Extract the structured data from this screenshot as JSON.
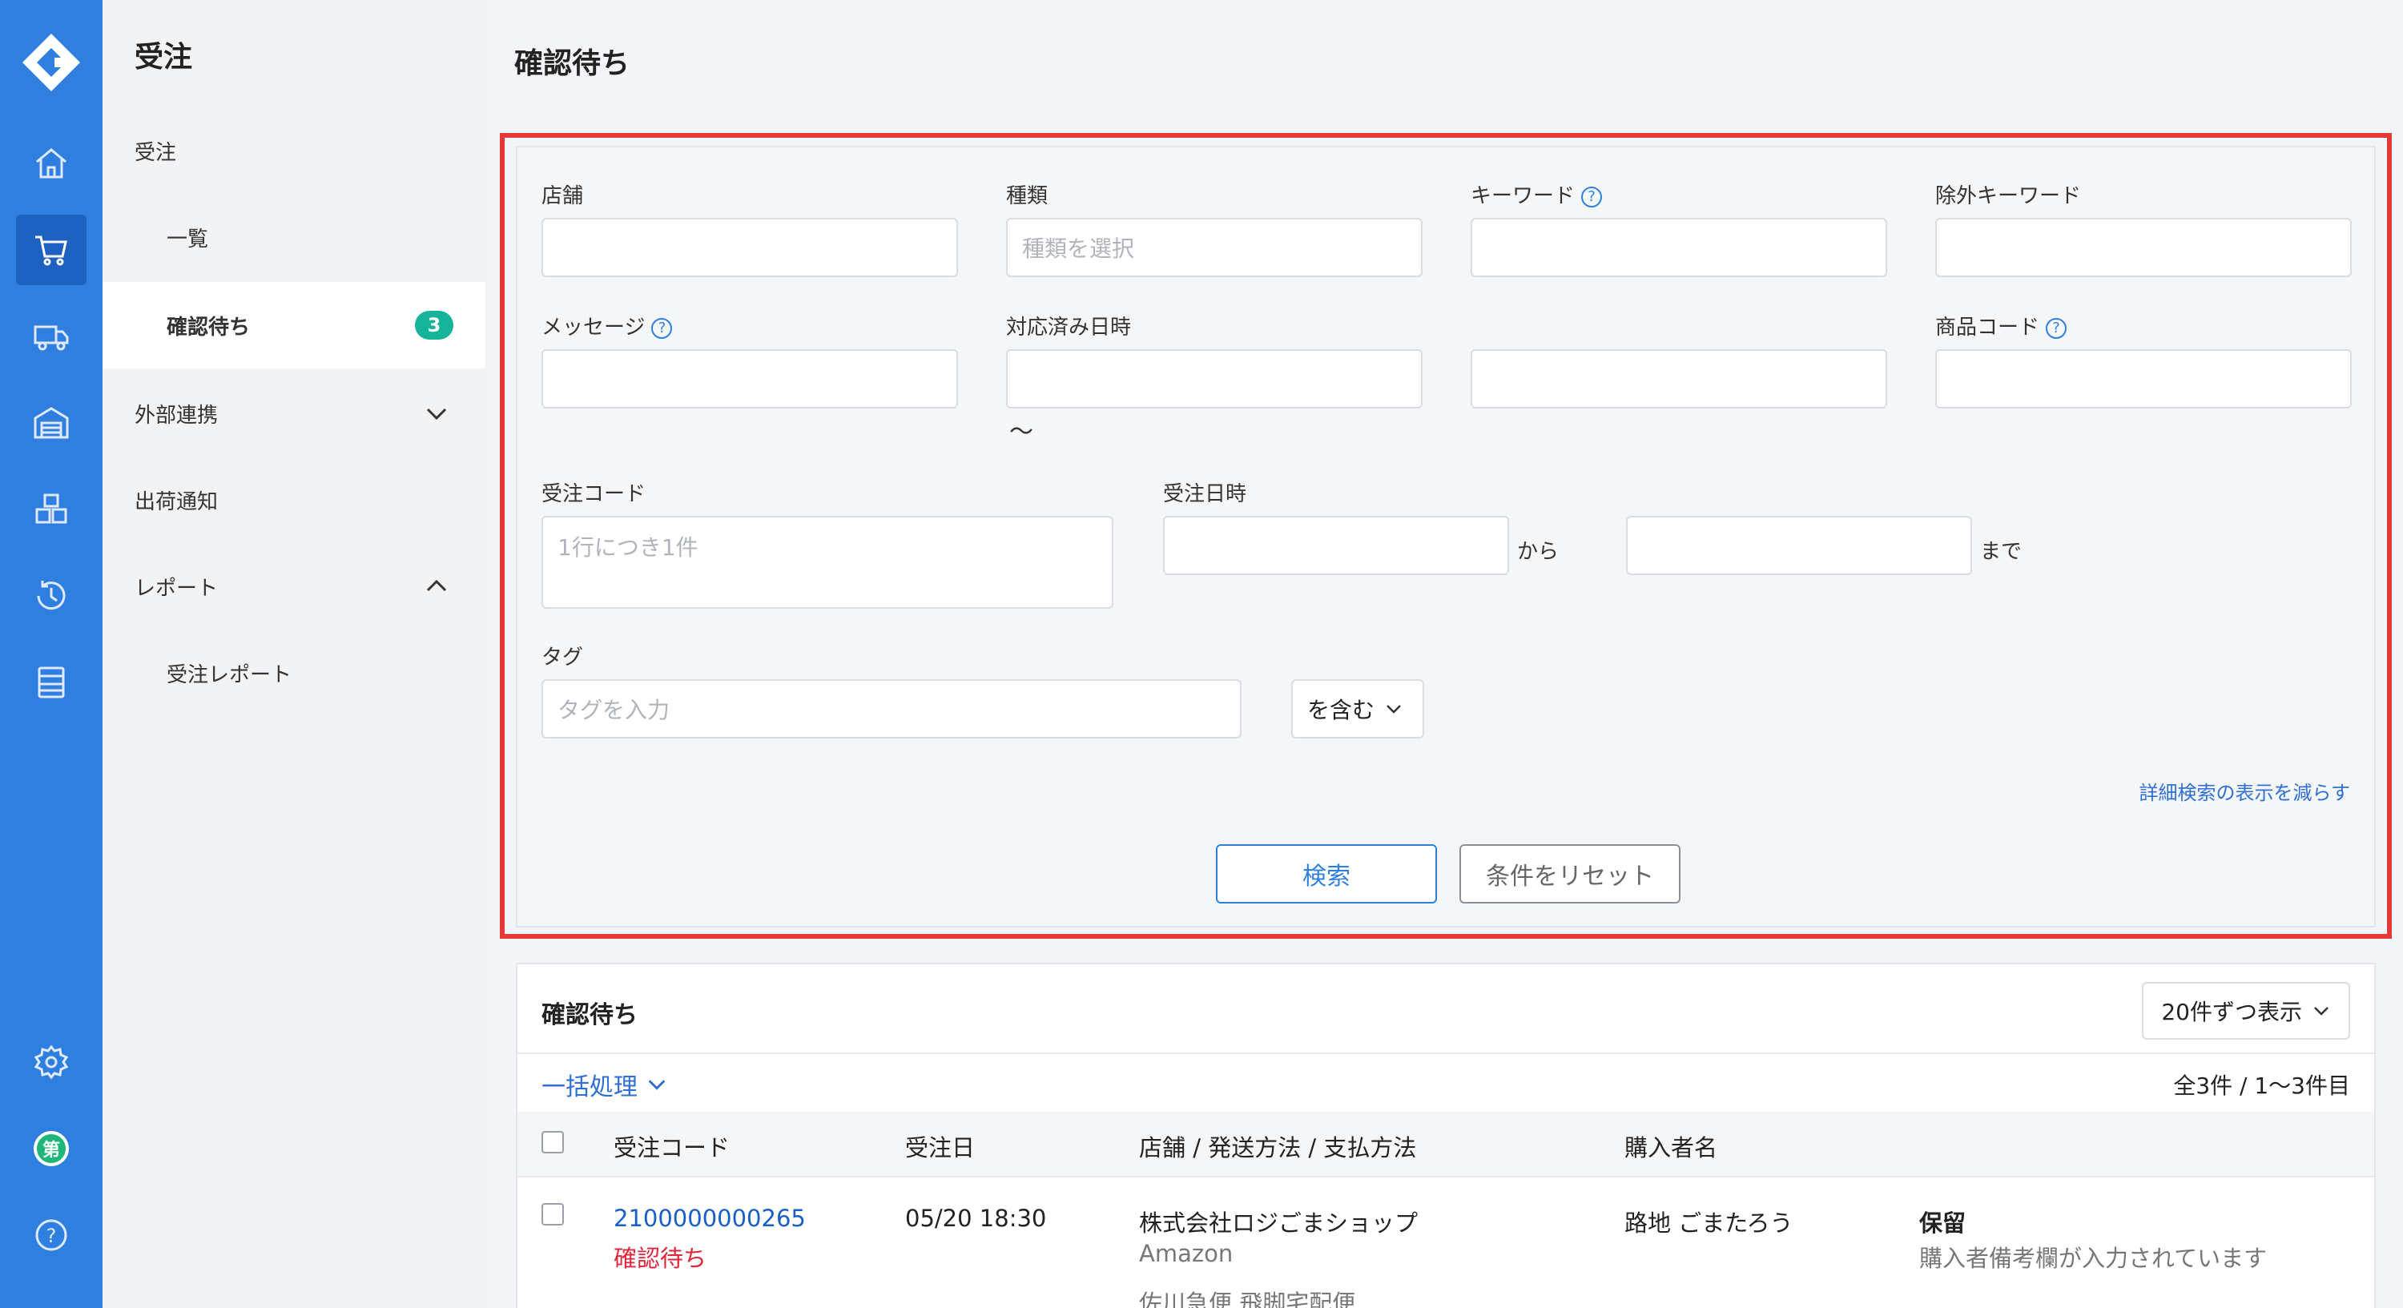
{
  "colors": {
    "rail": "#2f7fe0",
    "accent": "#2f7fe0",
    "badge": "#15b39a",
    "highlight": "#e53935",
    "status_red": "#e0263b"
  },
  "rail": {
    "icons": [
      "logo-icon",
      "home-icon",
      "cart-icon",
      "truck-icon",
      "warehouse-icon",
      "boxes-icon",
      "history-icon",
      "list-icon",
      "settings-icon",
      "user-avatar",
      "help-icon"
    ],
    "avatar_text": "第",
    "help_text": "?"
  },
  "subnav": {
    "title": "受注",
    "items": [
      {
        "label": "受注"
      },
      {
        "label": "一覧"
      },
      {
        "label": "確認待ち",
        "badge": "3"
      },
      {
        "label": "外部連携"
      },
      {
        "label": "出荷通知"
      },
      {
        "label": "レポート"
      },
      {
        "label": "受注レポート"
      }
    ]
  },
  "page": {
    "title": "確認待ち"
  },
  "search": {
    "store_label": "店舗",
    "type_label": "種類",
    "type_placeholder": "種類を選択",
    "keyword_label": "キーワード",
    "exclude_keyword_label": "除外キーワード",
    "message_label": "メッセージ",
    "handled_datetime_label": "対応済み日時",
    "tilde": "〜",
    "product_code_label": "商品コード",
    "order_code_label": "受注コード",
    "order_code_placeholder": "1行につき1件",
    "order_datetime_label": "受注日時",
    "from_text": "から",
    "to_text": "まで",
    "tag_label": "タグ",
    "tag_placeholder": "タグを入力",
    "tag_mode": "を含む",
    "reduce_link": "詳細検索の表示を減らす",
    "search_button": "検索",
    "reset_button": "条件をリセット",
    "help_glyph": "?"
  },
  "results": {
    "title": "確認待ち",
    "per_page": "20件ずつ表示",
    "bulk": "一括処理",
    "count": "全3件 / 1〜3件目",
    "columns": [
      "受注コード",
      "受注日",
      "店舗 / 発送方法 / 支払方法",
      "購入者名"
    ],
    "rows": [
      {
        "code": "2100000000265",
        "status": "確認待ち",
        "date": "05/20 18:30",
        "store": "株式会社ロジごまショップ",
        "channel": "Amazon",
        "shipping": "佐川急便 飛脚宅配便",
        "buyer": "路地 ごまたろう",
        "flag": "保留",
        "note": "購入者備考欄が入力されています"
      }
    ]
  }
}
